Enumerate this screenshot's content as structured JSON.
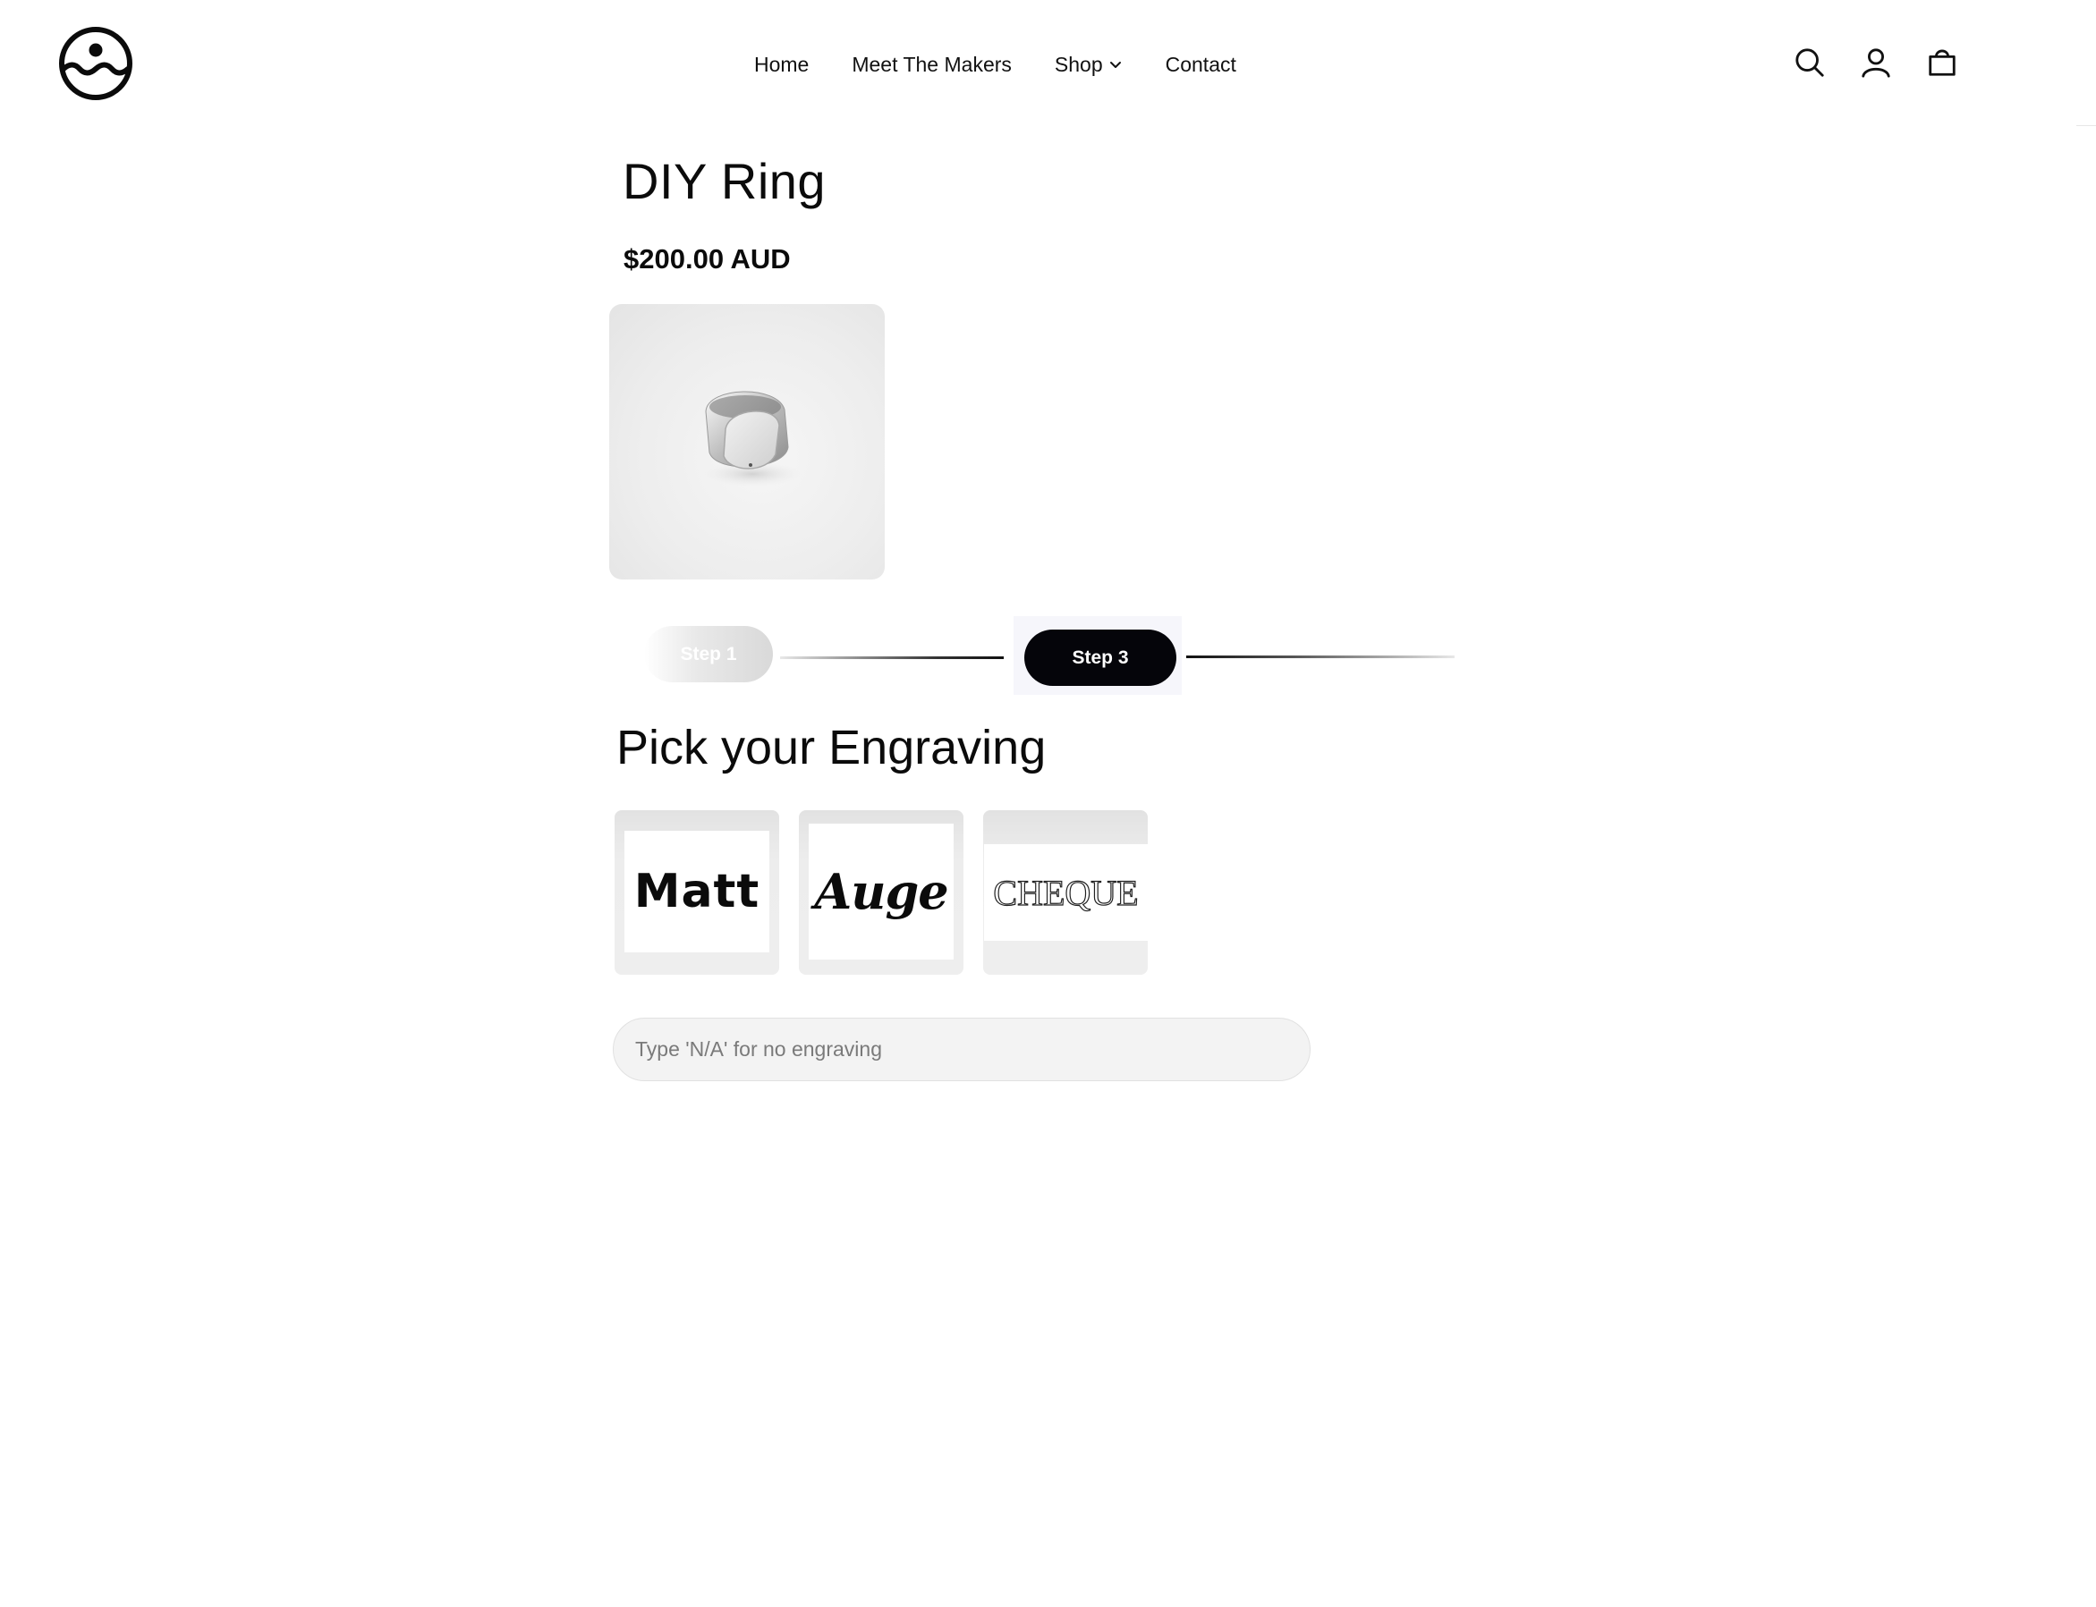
{
  "header": {
    "nav": [
      {
        "label": "Home"
      },
      {
        "label": "Meet The Makers"
      },
      {
        "label": "Shop"
      },
      {
        "label": "Contact"
      }
    ],
    "icons": [
      "search-icon",
      "account-icon",
      "cart-icon"
    ]
  },
  "product": {
    "title": "DIY Ring",
    "price": "$200.00 AUD",
    "image_alt": "silver signet ring"
  },
  "steps": {
    "previous_label": "Step 1",
    "current_label": "Step 3"
  },
  "engraving": {
    "title": "Pick your Engraving",
    "options": [
      {
        "label": "Matt"
      },
      {
        "label": "Auge"
      },
      {
        "label": "CHEQUE"
      }
    ],
    "input_placeholder": "Type 'N/A' for no engraving",
    "input_value": ""
  },
  "colors": {
    "text": "#0b0b0b",
    "active_step": "#05050a",
    "input_bg": "#f3f3f3"
  }
}
